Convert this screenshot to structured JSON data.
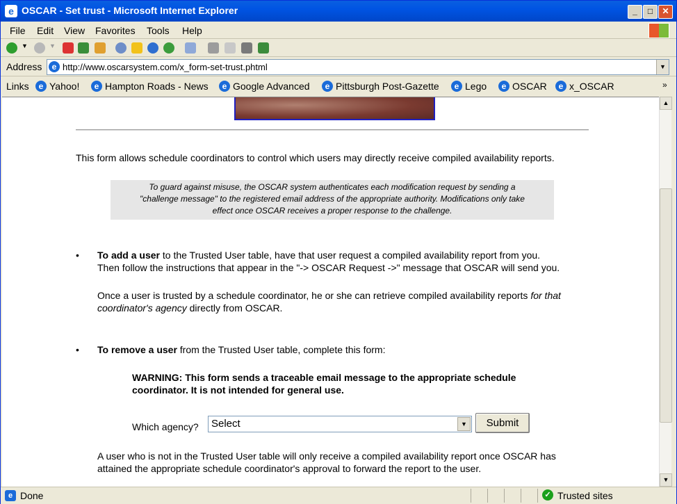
{
  "window": {
    "title": "OSCAR - Set trust - Microsoft Internet Explorer",
    "min_glyph": "_",
    "max_glyph": "□",
    "close_glyph": "✕"
  },
  "menu": [
    "File",
    "Edit",
    "View",
    "Favorites",
    "Tools",
    "Help"
  ],
  "address": {
    "label": "Address",
    "url": "http://www.oscarsystem.com/x_form-set-trust.phtml"
  },
  "links": {
    "label": "Links",
    "items": [
      "Yahoo!",
      "Hampton Roads - News",
      "Google Advanced",
      "Pittsburgh Post-Gazette",
      "Lego",
      "OSCAR",
      "x_OSCAR"
    ],
    "more": "»"
  },
  "page": {
    "intro": "This form allows schedule coordinators to control which users may directly receive compiled availability reports.",
    "note_line1": "To guard against misuse, the OSCAR system authenticates each modification request by sending a",
    "note_line2": "\"challenge message\" to the registered email address of the appropriate authority.  Modifications only take",
    "note_line3": "effect once OSCAR receives a proper response to the challenge.",
    "bullet": "•",
    "add_bold": "To add a user",
    "add_rest1": " to the Trusted User table, have that user request a compiled availability report from you.",
    "add_line2": "Then follow the instructions that appear in the \"-> OSCAR Request ->\" message that OSCAR will send you.",
    "trusted_pre": "Once a user is trusted by a schedule coordinator, he or she can retrieve compiled availability reports ",
    "trusted_italic": "for that coordinator's agency",
    "trusted_post": " directly from OSCAR.",
    "remove_bold": "To remove a user",
    "remove_rest": " from the Trusted User table, complete this form:",
    "warning_line1": "WARNING:  This form sends a traceable email message to the appropriate schedule",
    "warning_line2": "coordinator.  It is not intended for general use.",
    "agency_label": "Which agency?",
    "agency_value": "Select",
    "submit_label": "Submit",
    "footer_line1": "A user who is not in the Trusted User table will only receive a compiled availability report once OSCAR has",
    "footer_line2": "attained the appropriate schedule coordinator's approval to forward the report to the user."
  },
  "status": {
    "text": "Done",
    "zone": "Trusted sites"
  }
}
